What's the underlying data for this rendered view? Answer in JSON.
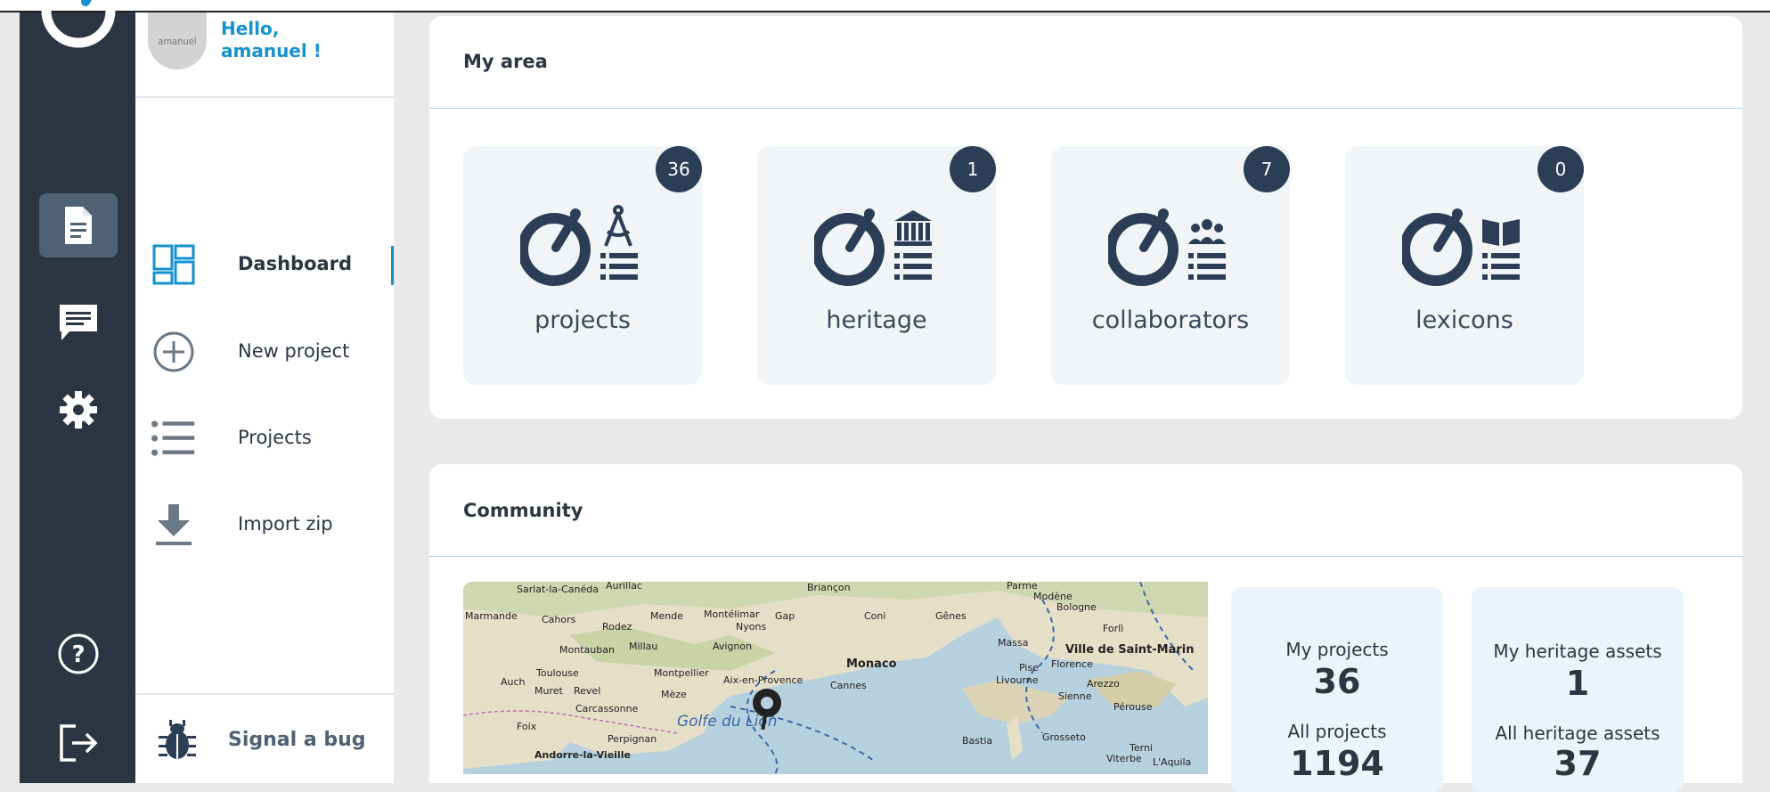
{
  "user": {
    "avatar_text": "amanuel",
    "greeting_line1": "Hello,",
    "greeting_line2": "amanuel !"
  },
  "nav": {
    "dashboard": "Dashboard",
    "new_project": "New project",
    "projects": "Projects",
    "import_zip": "Import zip",
    "signal_bug": "Signal a bug"
  },
  "my_area": {
    "title": "My area",
    "tiles": [
      {
        "label": "projects",
        "count": "36",
        "icon": "projects-compass-icon"
      },
      {
        "label": "heritage",
        "count": "1",
        "icon": "heritage-building-icon"
      },
      {
        "label": "collaborators",
        "count": "7",
        "icon": "collaborators-people-icon"
      },
      {
        "label": "lexicons",
        "count": "0",
        "icon": "lexicons-book-icon"
      }
    ]
  },
  "community": {
    "title": "Community",
    "map_places": [
      "Aurillac",
      "Briançon",
      "Parme",
      "Modène",
      "Bologne",
      "Sarlat-la-Canéda",
      "Marmande",
      "Cahors",
      "Rodez",
      "Mende",
      "Montélimar",
      "Gap",
      "Coni",
      "Gênes",
      "Forlì",
      "Nyons",
      "Montauban",
      "Millau",
      "Avignon",
      "Monaco",
      "Massa",
      "Ville de Saint-Marin",
      "Auch",
      "Toulouse",
      "Montpellier",
      "Aix-en-Provence",
      "Cannes",
      "Pise",
      "Florence",
      "Muret",
      "Revel",
      "Mèze",
      "Livourne",
      "Arezzo",
      "Carcassonne",
      "Golfe du Lion",
      "Sienne",
      "Pérouse",
      "Foix",
      "Perpignan",
      "Bastia",
      "Grosseto",
      "Terni",
      "Andorre-la-Vieille",
      "Viterbe",
      "L'Aquila"
    ],
    "my_projects_label": "My projects",
    "my_projects": "36",
    "all_projects_label": "All projects",
    "all_projects": "1194",
    "my_heritage_label": "My heritage assets",
    "my_heritage": "1",
    "all_heritage_label": "All heritage assets",
    "all_heritage": "37"
  },
  "colors": {
    "rail": "#2c3642",
    "accent": "#1591cf",
    "badge": "#2c3e55",
    "tile": "#f2f5f8",
    "stat": "#eaf5fb"
  },
  "rail_icons": [
    "document-icon",
    "chat-icon",
    "gear-icon",
    "help-icon",
    "logout-icon"
  ]
}
